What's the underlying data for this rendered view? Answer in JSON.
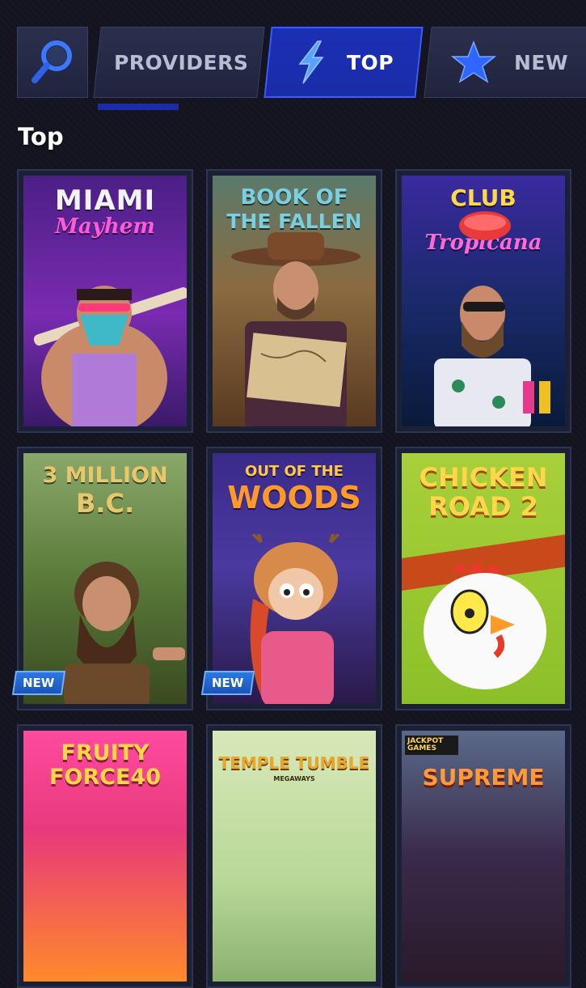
{
  "tabs": {
    "providers": "PROVIDERS",
    "top": "TOP",
    "new": "NEW"
  },
  "section": {
    "title": "Top"
  },
  "games": [
    {
      "title_line1": "MIAMI",
      "title_line2": "Mayhem",
      "badge": ""
    },
    {
      "title_line1": "BOOK OF",
      "title_line2": "THE FALLEN",
      "badge": ""
    },
    {
      "title_line1": "CLUB",
      "title_line2": "Tropicana",
      "badge": ""
    },
    {
      "title_line1": "3 MILLION",
      "title_line2": "B.C.",
      "badge": "NEW"
    },
    {
      "title_line1": "OUT OF THE",
      "title_line2": "WOODS",
      "badge": "NEW"
    },
    {
      "title_line1": "CHICKEN",
      "title_line2": "ROAD 2",
      "badge": ""
    },
    {
      "title_line1": "FRUITY",
      "title_line2": "FORCE40",
      "badge": ""
    },
    {
      "title_line1": "TEMPLE TUMBLE",
      "title_line2": "MEGAWAYS",
      "badge": ""
    },
    {
      "title_line1": "JACKPOT GAMES",
      "title_line2": "SUPREME",
      "badge": ""
    }
  ],
  "colors": {
    "background": "#13141f",
    "tab": "#242945",
    "tab_active": "#1b2fb6",
    "badge": "#2b78e4"
  }
}
